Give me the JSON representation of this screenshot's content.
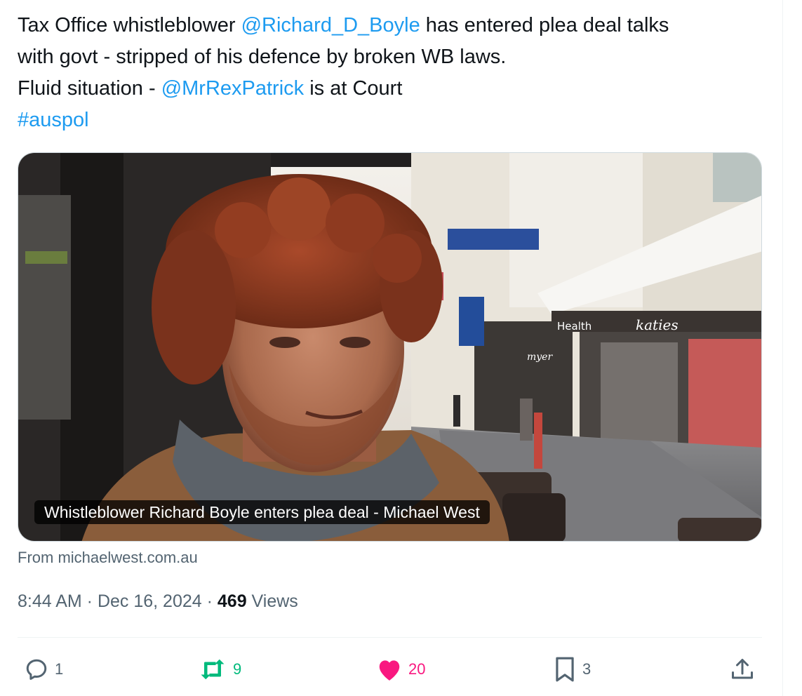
{
  "tweet": {
    "text_line1_pre": "Tax Office whistleblower ",
    "mention1": "@Richard_D_Boyle",
    "text_line1_post": " has entered plea deal talks",
    "text_line2": "with govt - stripped of his defence by broken WB laws.",
    "text_line3_pre": "Fluid situation - ",
    "mention2": "@MrRexPatrick",
    "text_line3_post": " is at Court",
    "hashtag": "#auspol"
  },
  "card": {
    "caption": "Whistleblower Richard Boyle enters plea deal - Michael West",
    "source": "From michaelwest.com.au",
    "image_description": "man-with-red-curly-hair-on-city-street",
    "sign_health": "Health",
    "sign_katies": "katies",
    "sign_myer": "myer"
  },
  "meta": {
    "time": "8:44 AM",
    "sep1": " · ",
    "date": "Dec 16, 2024",
    "sep2": " · ",
    "views_count": "469",
    "views_label": " Views"
  },
  "actions": {
    "reply": {
      "icon": "reply-icon",
      "count": "1",
      "color": "#536471"
    },
    "retweet": {
      "icon": "retweet-icon",
      "count": "9",
      "color": "#00ba7c"
    },
    "like": {
      "icon": "heart-icon",
      "count": "20",
      "color": "#f91880"
    },
    "bookmark": {
      "icon": "bookmark-icon",
      "count": "3",
      "color": "#536471"
    },
    "share": {
      "icon": "share-icon",
      "color": "#536471"
    }
  },
  "colors": {
    "link": "#1d9bf0",
    "text": "#0f1419",
    "muted": "#536471"
  }
}
